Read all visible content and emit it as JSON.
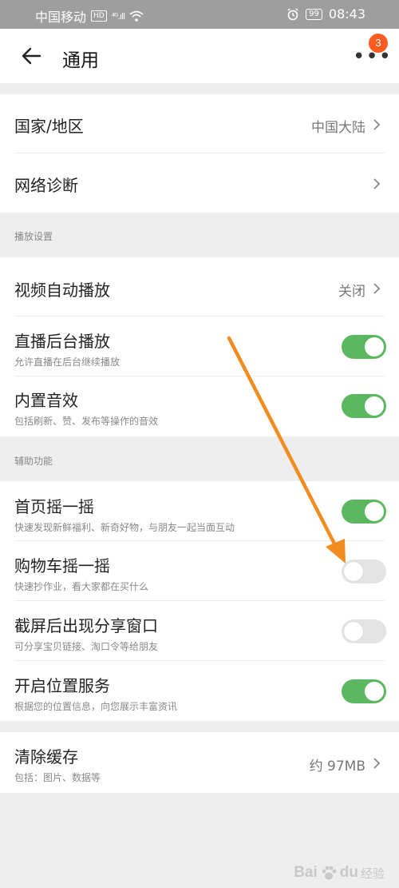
{
  "status_bar": {
    "carrier": "中国移动",
    "network_badge": "HD",
    "signal": "⁴ᴳ.ıll",
    "wifi_icon": "wifi-icon",
    "alarm_icon": "alarm-icon",
    "battery": "99",
    "time": "08:43"
  },
  "header": {
    "title": "通用",
    "notification_count": "3"
  },
  "general_items": [
    {
      "label": "国家/地区",
      "value": "中国大陆"
    },
    {
      "label": "网络诊断",
      "value": ""
    }
  ],
  "playback_section": {
    "title": "播放设置",
    "video_autoplay": {
      "label": "视频自动播放",
      "value": "关闭"
    },
    "live_background": {
      "label": "直播后台播放",
      "subtitle": "允许直播在后台继续播放",
      "enabled": true
    },
    "sound_effects": {
      "label": "内置音效",
      "subtitle": "包括刷新、赞、发布等操作的音效",
      "enabled": true
    }
  },
  "accessibility_section": {
    "title": "辅助功能",
    "items": [
      {
        "label": "首页摇一摇",
        "subtitle": "快速发现新鲜福利、新奇好物，与朋友一起当面互动",
        "enabled": true
      },
      {
        "label": "购物车摇一摇",
        "subtitle": "快速抄作业，看大家都在买什么",
        "enabled": false
      },
      {
        "label": "截屏后出现分享窗口",
        "subtitle": "可分享宝贝链接、淘口令等给朋友",
        "enabled": false
      },
      {
        "label": "开启位置服务",
        "subtitle": "根据您的位置信息，向您展示丰富资讯",
        "enabled": true
      }
    ]
  },
  "cache": {
    "label": "清除缓存",
    "subtitle": "包括：图片、数据等",
    "value": "约 97MB"
  },
  "annotation_arrow_color": "#f28c1e",
  "toggle_on_color": "#5cb860",
  "watermark": {
    "brand": "Bai",
    "brand_end": "du",
    "cn": "经验"
  }
}
